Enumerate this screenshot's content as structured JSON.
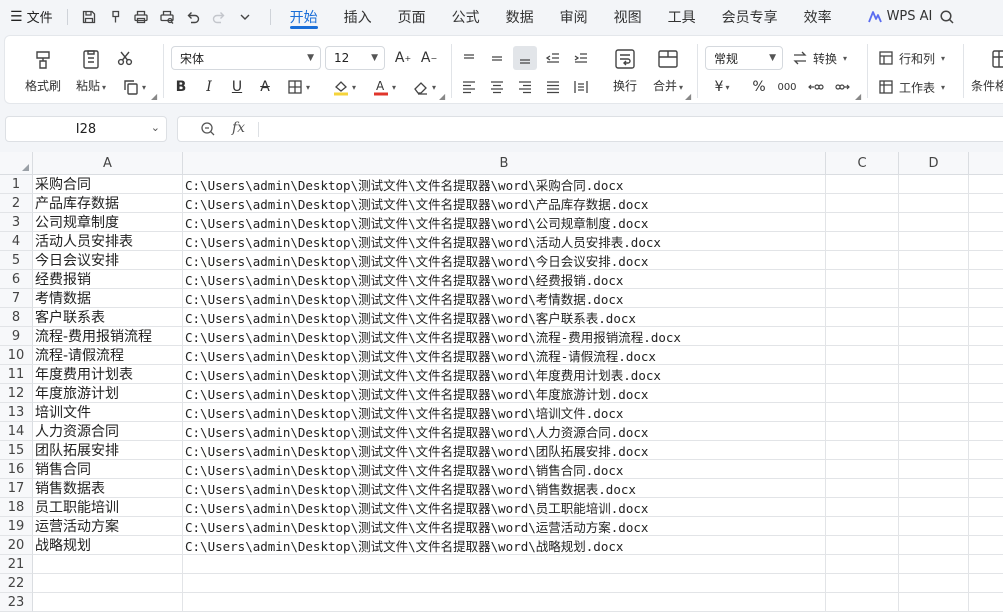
{
  "menu": {
    "file_label": "文件",
    "tabs": [
      "开始",
      "插入",
      "页面",
      "公式",
      "数据",
      "审阅",
      "视图",
      "工具",
      "会员专享",
      "效率"
    ],
    "active_tab": "开始",
    "ai_label": "WPS AI"
  },
  "ribbon": {
    "format_painter": "格式刷",
    "paste": "粘贴",
    "font_name": "宋体",
    "font_size": "12",
    "wrap_text": "换行",
    "merge": "合并",
    "number_format": "常规",
    "convert": "转换",
    "rows_cols": "行和列",
    "worksheet": "工作表",
    "conditional": "条件格",
    "currency_symbol": "¥",
    "percent_symbol": "%",
    "thousands_symbol": "000",
    "font_color": "#e0352b",
    "fill_color": "#f5d33a"
  },
  "formula_bar": {
    "cell_ref": "I28",
    "fx": "fx",
    "formula": ""
  },
  "sheet": {
    "columns": [
      "A",
      "B",
      "C",
      "D"
    ],
    "row_numbers": [
      "1",
      "2",
      "3",
      "4",
      "5",
      "6",
      "7",
      "8",
      "9",
      "10",
      "11",
      "12",
      "13",
      "14",
      "15",
      "16",
      "17",
      "18",
      "19",
      "20",
      "21",
      "22",
      "23"
    ],
    "rows": [
      {
        "a": "采购合同",
        "b": "C:\\Users\\admin\\Desktop\\测试文件\\文件名提取器\\word\\采购合同.docx"
      },
      {
        "a": "产品库存数据",
        "b": "C:\\Users\\admin\\Desktop\\测试文件\\文件名提取器\\word\\产品库存数据.docx"
      },
      {
        "a": "公司规章制度",
        "b": "C:\\Users\\admin\\Desktop\\测试文件\\文件名提取器\\word\\公司规章制度.docx"
      },
      {
        "a": "活动人员安排表",
        "b": "C:\\Users\\admin\\Desktop\\测试文件\\文件名提取器\\word\\活动人员安排表.docx"
      },
      {
        "a": "今日会议安排",
        "b": "C:\\Users\\admin\\Desktop\\测试文件\\文件名提取器\\word\\今日会议安排.docx"
      },
      {
        "a": "经费报销",
        "b": "C:\\Users\\admin\\Desktop\\测试文件\\文件名提取器\\word\\经费报销.docx"
      },
      {
        "a": "考情数据",
        "b": "C:\\Users\\admin\\Desktop\\测试文件\\文件名提取器\\word\\考情数据.docx"
      },
      {
        "a": "客户联系表",
        "b": "C:\\Users\\admin\\Desktop\\测试文件\\文件名提取器\\word\\客户联系表.docx"
      },
      {
        "a": "流程-费用报销流程",
        "b": "C:\\Users\\admin\\Desktop\\测试文件\\文件名提取器\\word\\流程-费用报销流程.docx"
      },
      {
        "a": "流程-请假流程",
        "b": "C:\\Users\\admin\\Desktop\\测试文件\\文件名提取器\\word\\流程-请假流程.docx"
      },
      {
        "a": "年度费用计划表",
        "b": "C:\\Users\\admin\\Desktop\\测试文件\\文件名提取器\\word\\年度费用计划表.docx"
      },
      {
        "a": "年度旅游计划",
        "b": "C:\\Users\\admin\\Desktop\\测试文件\\文件名提取器\\word\\年度旅游计划.docx"
      },
      {
        "a": "培训文件",
        "b": "C:\\Users\\admin\\Desktop\\测试文件\\文件名提取器\\word\\培训文件.docx"
      },
      {
        "a": "人力资源合同",
        "b": "C:\\Users\\admin\\Desktop\\测试文件\\文件名提取器\\word\\人力资源合同.docx"
      },
      {
        "a": "团队拓展安排",
        "b": "C:\\Users\\admin\\Desktop\\测试文件\\文件名提取器\\word\\团队拓展安排.docx"
      },
      {
        "a": "销售合同",
        "b": "C:\\Users\\admin\\Desktop\\测试文件\\文件名提取器\\word\\销售合同.docx"
      },
      {
        "a": "销售数据表",
        "b": "C:\\Users\\admin\\Desktop\\测试文件\\文件名提取器\\word\\销售数据表.docx"
      },
      {
        "a": "员工职能培训",
        "b": "C:\\Users\\admin\\Desktop\\测试文件\\文件名提取器\\word\\员工职能培训.docx"
      },
      {
        "a": "运营活动方案",
        "b": "C:\\Users\\admin\\Desktop\\测试文件\\文件名提取器\\word\\运营活动方案.docx"
      },
      {
        "a": "战略规划",
        "b": "C:\\Users\\admin\\Desktop\\测试文件\\文件名提取器\\word\\战略规划.docx"
      },
      {
        "a": "",
        "b": ""
      },
      {
        "a": "",
        "b": ""
      },
      {
        "a": "",
        "b": ""
      }
    ]
  }
}
